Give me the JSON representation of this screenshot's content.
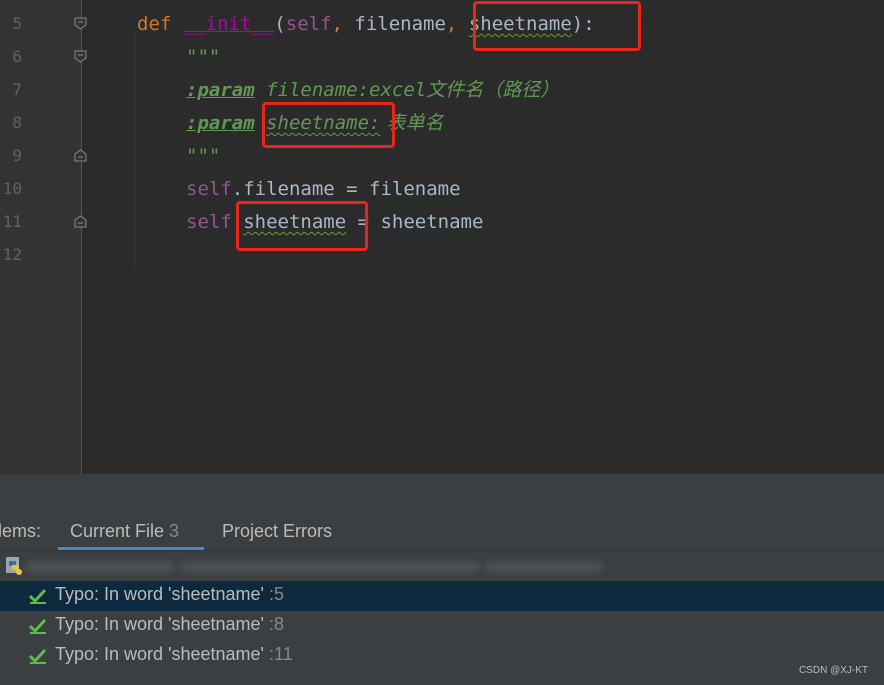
{
  "editor": {
    "line_numbers": [
      "5",
      "6",
      "7",
      "8",
      "9",
      "10",
      "11",
      "12"
    ],
    "lines": {
      "l5": {
        "kw": "def",
        "fn": "__init__",
        "open": "(",
        "self": "self",
        ", ": ", ",
        "filename": "filename",
        "comma2": ", ",
        "sheetname": "sheetname",
        "close": "):"
      },
      "l6": {
        "doc": "\"\"\""
      },
      "l7": {
        "tag": ":param",
        "rest": " filename:excel",
        "cjk": "文件名（路径）"
      },
      "l8": {
        "tag": ":param",
        "space": " ",
        "word": "sheetname:",
        "cjk": " 表单名"
      },
      "l9": {
        "doc": "\"\"\""
      },
      "l10": {
        "self": "self",
        "text": ".filename = filename"
      },
      "l11": {
        "self": "self",
        "dot": ".",
        "word": "sheetname",
        "rest": " = sheetname"
      }
    }
  },
  "problems": {
    "title_fragment": "lems:",
    "tabs": [
      {
        "label": "Current File",
        "count": "3"
      },
      {
        "label": "Project Errors"
      }
    ],
    "items": [
      {
        "text": "Typo: In word 'sheetname'",
        "loc": ":5"
      },
      {
        "text": "Typo: In word 'sheetname'",
        "loc": ":8"
      },
      {
        "text": "Typo: In word 'sheetname'",
        "loc": ":11"
      }
    ]
  },
  "watermark": "CSDN @XJ-KT",
  "colors": {
    "highlight_box": "#e8261a",
    "selection": "#0d293e",
    "check": "#5bbf45"
  }
}
